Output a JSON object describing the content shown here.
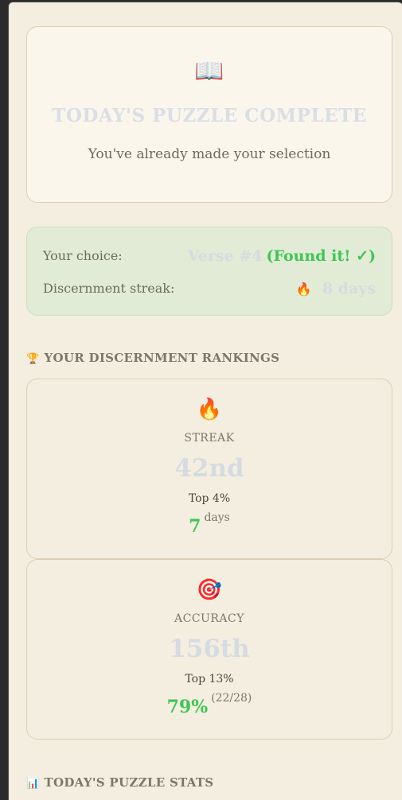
{
  "complete": {
    "icon": "open-book-icon",
    "icon_glyph": "📖",
    "title": "TODAY'S PUZZLE COMPLETE",
    "subtitle": "You've already made your selection"
  },
  "choice": {
    "choice_label": "Your choice:",
    "choice_verse": "Verse #4",
    "choice_result": "(Found it! ✓)",
    "streak_label": "Discernment streak:",
    "streak_icon": "fire-icon",
    "streak_icon_glyph": "🔥",
    "streak_value": "8 days"
  },
  "rankings": {
    "header_icon": "trophy-icon",
    "header_icon_glyph": "🏆",
    "header": "YOUR DISCERNMENT RANKINGS",
    "cards": [
      {
        "icon": "fire-icon",
        "icon_glyph": "🔥",
        "name": "STREAK",
        "place": "42nd",
        "top": "Top 4%",
        "metric_value": "7",
        "metric_suffix": "days"
      },
      {
        "icon": "target-icon",
        "icon_glyph": "🎯",
        "name": "ACCURACY",
        "place": "156th",
        "top": "Top 13%",
        "metric_value": "79%",
        "metric_suffix": "(22/28)"
      }
    ]
  },
  "stats": {
    "header_icon": "bar-chart-icon",
    "header_icon_glyph": "📊",
    "header": "TODAY'S PUZZLE STATS"
  },
  "colors": {
    "background": "#f4eee0",
    "accent_green": "#3ec653",
    "faded_text": "#d6dbe2"
  }
}
